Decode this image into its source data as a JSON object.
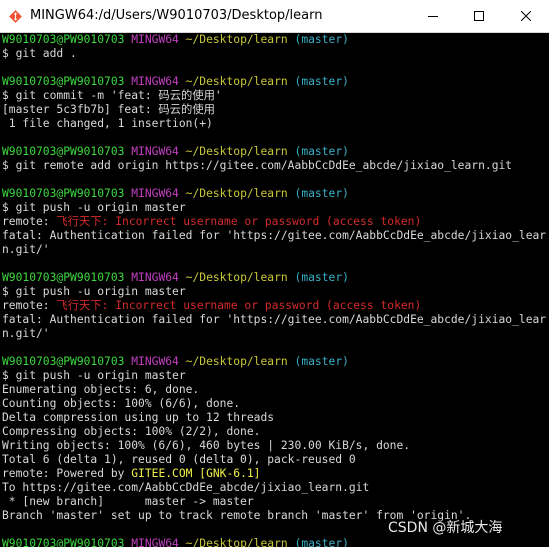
{
  "window": {
    "title": "MINGW64:/d/Users/W9010703/Desktop/learn"
  },
  "prompt": {
    "user": "W9010703@PW9010703",
    "shell": "MINGW64",
    "path": "~/Desktop/learn",
    "branch": "(master)"
  },
  "terminal": {
    "cmd_add": "$ git add .",
    "cmd_commit": "$ git commit -m 'feat: 码云的使用'",
    "commit_out1": "[master 5c3fb7b] feat: 码云的使用",
    "commit_out2": " 1 file changed, 1 insertion(+)",
    "cmd_remote": "$ git remote add origin https://gitee.com/AabbCcDdEe_abcde/jixiao_learn.git",
    "cmd_push": "$ git push -u origin master",
    "remote_prefix": "remote: ",
    "remote_error": "飞行天下: Incorrect username or password (access token)",
    "fatal_line1": "fatal: Authentication failed for 'https://gitee.com/AabbCcDdEe_abcde/jixiao_lear",
    "fatal_line2": "n.git/'",
    "enum": "Enumerating objects: 6, done.",
    "counting": "Counting objects: 100% (6/6), done.",
    "delta": "Delta compression using up to 12 threads",
    "compressing": "Compressing objects: 100% (2/2), done.",
    "writing": "Writing objects: 100% (6/6), 460 bytes | 230.00 KiB/s, done.",
    "total": "Total 6 (delta 1), reused 0 (delta 0), pack-reused 0",
    "powered_prefix": "remote: Powered by ",
    "powered_brand": "GITEE.COM",
    "powered_version": "[GNK-6.1]",
    "to_line": "To https://gitee.com/AabbCcDdEe_abcde/jixiao_learn.git",
    "new_branch": " * [new branch]      master -> master",
    "branch_track": "Branch 'master' set up to track remote branch 'master' from 'origin'."
  },
  "watermark": "CSDN @新城大海",
  "colors": {
    "prompt_user": "#3ed93e",
    "prompt_shell": "#c33fc3",
    "prompt_path": "#c8c83a",
    "prompt_branch": "#3ab0c8",
    "error": "#d42a2a",
    "brand": "#f0f04a",
    "output": "#d8d8d8",
    "background": "#000000"
  },
  "icons": {
    "app": "git-bash-icon",
    "minimize": "minimize-icon",
    "maximize": "maximize-icon",
    "close": "close-icon"
  }
}
